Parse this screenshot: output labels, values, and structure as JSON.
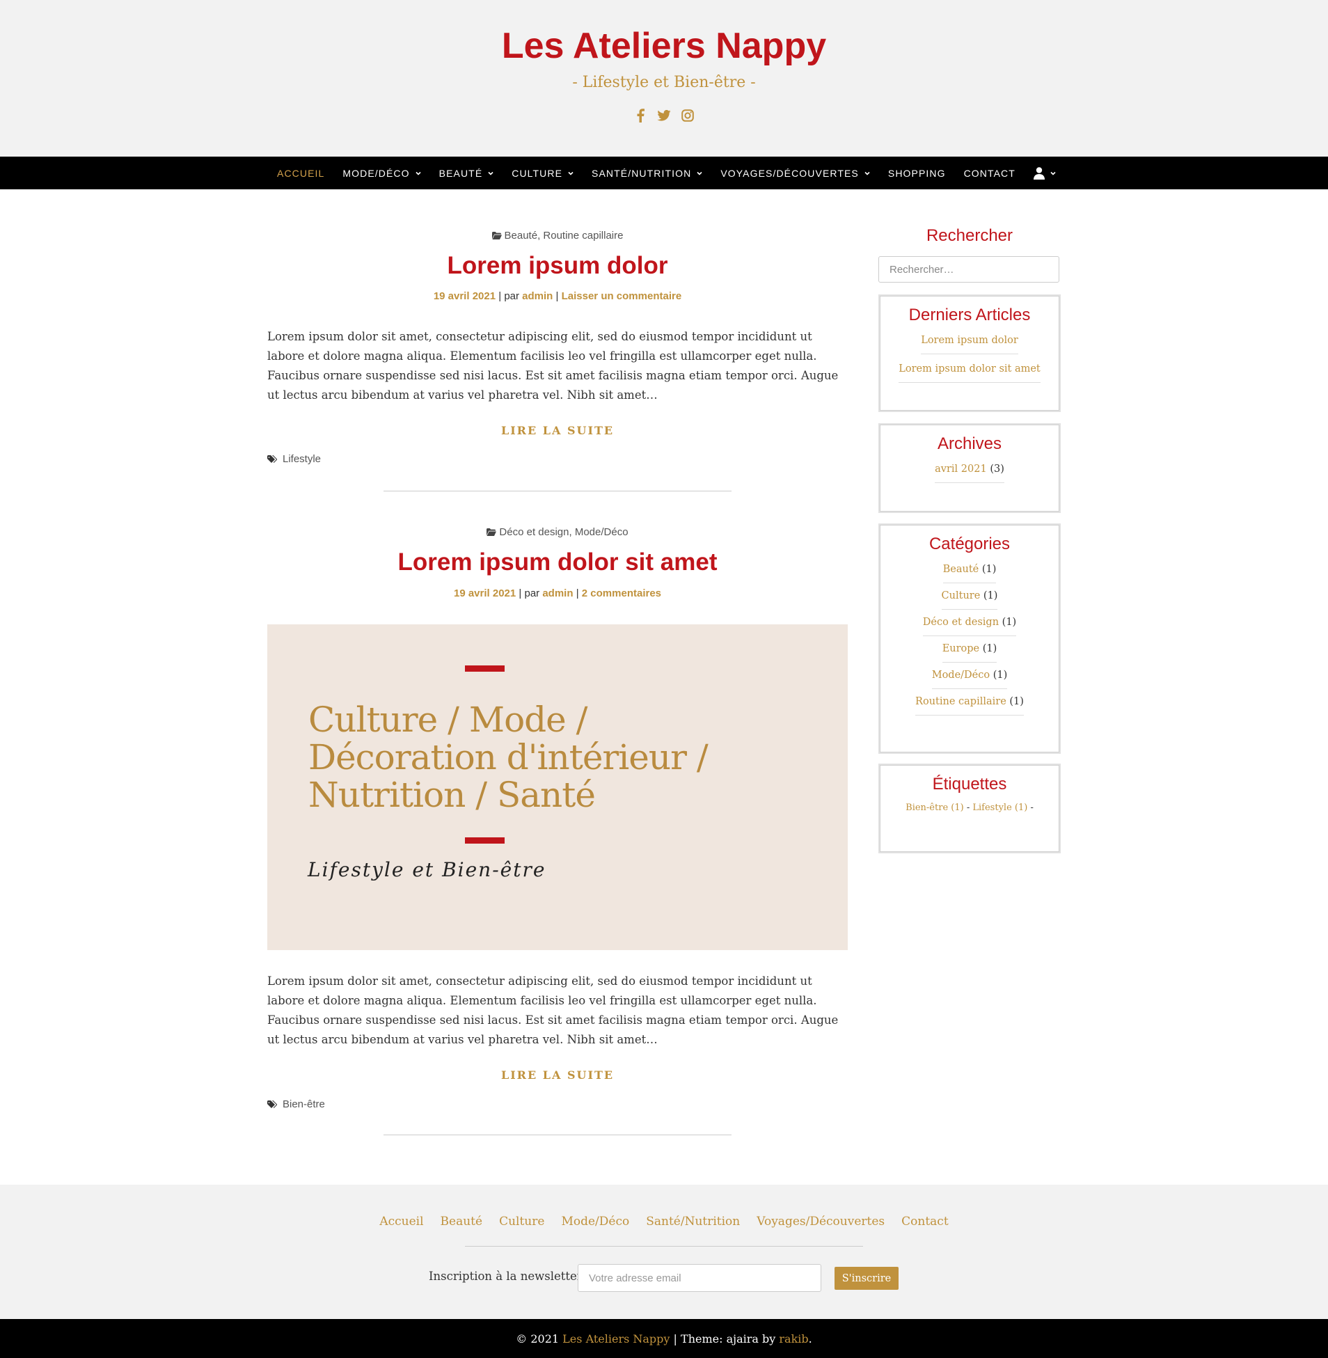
{
  "header": {
    "title": "Les Ateliers Nappy",
    "tagline": "-  Lifestyle et Bien-être  -",
    "social": [
      "facebook-icon",
      "twitter-icon",
      "instagram-icon"
    ]
  },
  "nav": {
    "items": [
      {
        "label": "ACCUEIL",
        "active": true,
        "dropdown": false
      },
      {
        "label": "MODE/DÉCO",
        "dropdown": true
      },
      {
        "label": "BEAUTÉ",
        "dropdown": true
      },
      {
        "label": "CULTURE",
        "dropdown": true
      },
      {
        "label": "SANTÉ/NUTRITION",
        "dropdown": true
      },
      {
        "label": "VOYAGES/DÉCOUVERTES",
        "dropdown": true
      },
      {
        "label": "SHOPPING",
        "dropdown": false
      },
      {
        "label": "CONTACT",
        "dropdown": false
      }
    ]
  },
  "posts": [
    {
      "categories": [
        "Beauté",
        "Routine capillaire"
      ],
      "title": "Lorem ipsum dolor",
      "date": "19 avril 2021",
      "by": "par",
      "author": "admin",
      "comments": "Laisser un commentaire",
      "excerpt": "Lorem ipsum dolor sit amet, consectetur adipiscing elit, sed do eiusmod tempor incididunt ut labore et dolore magna aliqua. Elementum facilisis leo vel fringilla est ullamcorper eget nulla. Faucibus ornare suspendisse sed nisi lacus. Est sit amet facilisis magna etiam tempor orci. Augue ut lectus arcu bibendum at varius vel pharetra vel. Nibh sit amet…",
      "read_more": "LIRE LA SUITE",
      "tag": "Lifestyle"
    },
    {
      "categories": [
        "Déco et design",
        "Mode/Déco"
      ],
      "title": "Lorem ipsum dolor sit amet",
      "date": "19 avril 2021",
      "by": "par",
      "author": "admin",
      "comments": "2 commentaires",
      "image": {
        "lines": [
          "Culture / Mode /",
          "Décoration d'intérieur /",
          "Nutrition / Santé"
        ],
        "script": "Lifestyle et Bien-être",
        "bg_color": "#f0e6de",
        "text_color": "#b98b3f"
      },
      "excerpt": "Lorem ipsum dolor sit amet, consectetur adipiscing elit, sed do eiusmod tempor incididunt ut labore et dolore magna aliqua. Elementum facilisis leo vel fringilla est ullamcorper eget nulla. Faucibus ornare suspendisse sed nisi lacus. Est sit amet facilisis magna etiam tempor orci. Augue ut lectus arcu bibendum at varius vel pharetra vel. Nibh sit amet…",
      "read_more": "LIRE LA SUITE",
      "tag": "Bien-être"
    }
  ],
  "sidebar": {
    "search": {
      "title": "Rechercher",
      "placeholder": "Rechercher…"
    },
    "recent": {
      "title": "Derniers Articles",
      "items": [
        "Lorem ipsum dolor",
        "Lorem ipsum dolor sit amet"
      ]
    },
    "archives": {
      "title": "Archives",
      "items": [
        {
          "label": "avril 2021",
          "count": "(3)"
        }
      ]
    },
    "categories": {
      "title": "Catégories",
      "items": [
        {
          "label": "Beauté",
          "count": "(1)"
        },
        {
          "label": "Culture",
          "count": "(1)"
        },
        {
          "label": "Déco et design",
          "count": "(1)"
        },
        {
          "label": "Europe",
          "count": "(1)"
        },
        {
          "label": "Mode/Déco",
          "count": "(1)"
        },
        {
          "label": "Routine capillaire",
          "count": "(1)"
        }
      ]
    },
    "tags": {
      "title": "Étiquettes",
      "items": [
        {
          "label": "Bien-être (1)"
        },
        {
          "label": "Lifestyle (1)"
        }
      ],
      "separator": "-"
    }
  },
  "footer": {
    "nav": [
      "Accueil",
      "Beauté",
      "Culture",
      "Mode/Déco",
      "Santé/Nutrition",
      "Voyages/Découvertes",
      "Contact"
    ],
    "newsletter_label": "Inscription à la newsletter",
    "newsletter_placeholder": "Votre adresse email",
    "newsletter_button": "S'inscrire",
    "copyright_prefix": "© 2021",
    "copyright_site": "Les Ateliers Nappy",
    "theme_text": "| Theme: ajaira by",
    "theme_author": "rakib",
    "end": "."
  },
  "colors": {
    "brand_red": "#c0151b",
    "gold": "#c0923d",
    "nav_bg": "#000000",
    "header_bg": "#f2f2f2"
  }
}
